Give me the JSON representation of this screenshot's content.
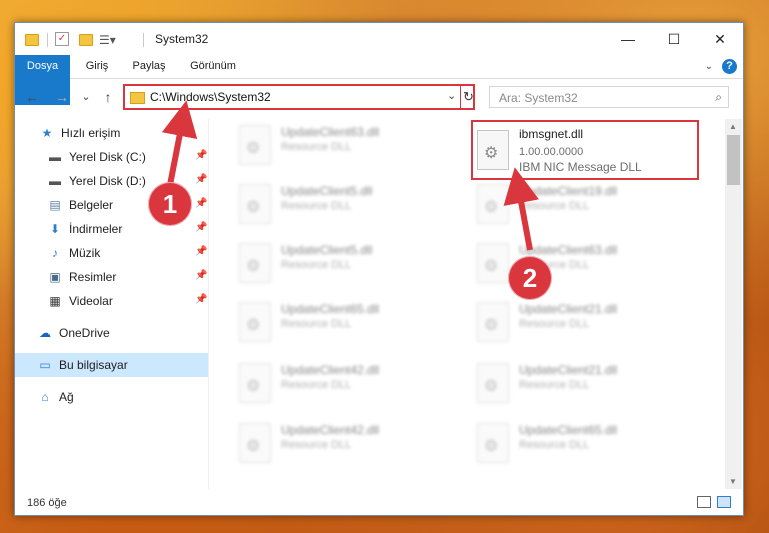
{
  "window": {
    "title": "System32",
    "controls": {
      "minimize": "—",
      "maximize": "☐",
      "close": "✕"
    }
  },
  "ribbon": {
    "tabs": [
      "Dosya",
      "Giriş",
      "Paylaş",
      "Görünüm"
    ],
    "help": "?"
  },
  "nav": {
    "back": "←",
    "forward": "→",
    "recent": "⌄",
    "up": "↑",
    "address": "C:\\Windows\\System32",
    "refresh": "↻",
    "dropdown": "⌄",
    "search_placeholder": "Ara: System32"
  },
  "sidebar": {
    "items": [
      {
        "label": "Hızlı erişim",
        "icon": "star-icon"
      },
      {
        "label": "Yerel Disk (C:)",
        "icon": "drive-icon",
        "pinned": true
      },
      {
        "label": "Yerel Disk (D:)",
        "icon": "drive-icon",
        "pinned": true
      },
      {
        "label": "Belgeler",
        "icon": "documents-icon",
        "pinned": true
      },
      {
        "label": "İndirmeler",
        "icon": "download-icon",
        "pinned": true
      },
      {
        "label": "Müzik",
        "icon": "music-icon",
        "pinned": true
      },
      {
        "label": "Resimler",
        "icon": "pictures-icon",
        "pinned": true
      },
      {
        "label": "Videolar",
        "icon": "video-icon",
        "pinned": true
      },
      {
        "label": "OneDrive",
        "icon": "cloud-icon"
      },
      {
        "label": "Bu bilgisayar",
        "icon": "computer-icon",
        "selected": true
      },
      {
        "label": "Ağ",
        "icon": "network-icon"
      }
    ]
  },
  "files": {
    "left_column": [
      {
        "name": "UpdateClient63.dll",
        "desc": "Resource DLL"
      },
      {
        "name": "UpdateClient5.dll",
        "desc": "Resource DLL"
      },
      {
        "name": "UpdateClient5.dll",
        "desc": "Resource DLL"
      },
      {
        "name": "UpdateClient65.dll",
        "desc": "Resource DLL"
      },
      {
        "name": "UpdateClient42.dll",
        "desc": "Resource DLL"
      },
      {
        "name": "UpdateClient42.dll",
        "desc": "Resource DLL"
      }
    ],
    "selected": {
      "name": "ibmsgnet.dll",
      "version": "1.00.00.0000",
      "desc": "IBM NIC Message DLL"
    },
    "right_column": [
      {
        "name": "UpdateClient19.dll",
        "desc": "Resource DLL"
      },
      {
        "name": "UpdateClient63.dll",
        "desc": "Resource DLL"
      },
      {
        "name": "UpdateClient21.dll",
        "desc": "Resource DLL"
      },
      {
        "name": "UpdateClient21.dll",
        "desc": "Resource DLL"
      },
      {
        "name": "UpdateClient65.dll",
        "desc": "Resource DLL"
      }
    ]
  },
  "status": {
    "count": "186 öğe"
  },
  "annotations": {
    "badge1": "1",
    "badge2": "2",
    "color": "#d9363e"
  }
}
